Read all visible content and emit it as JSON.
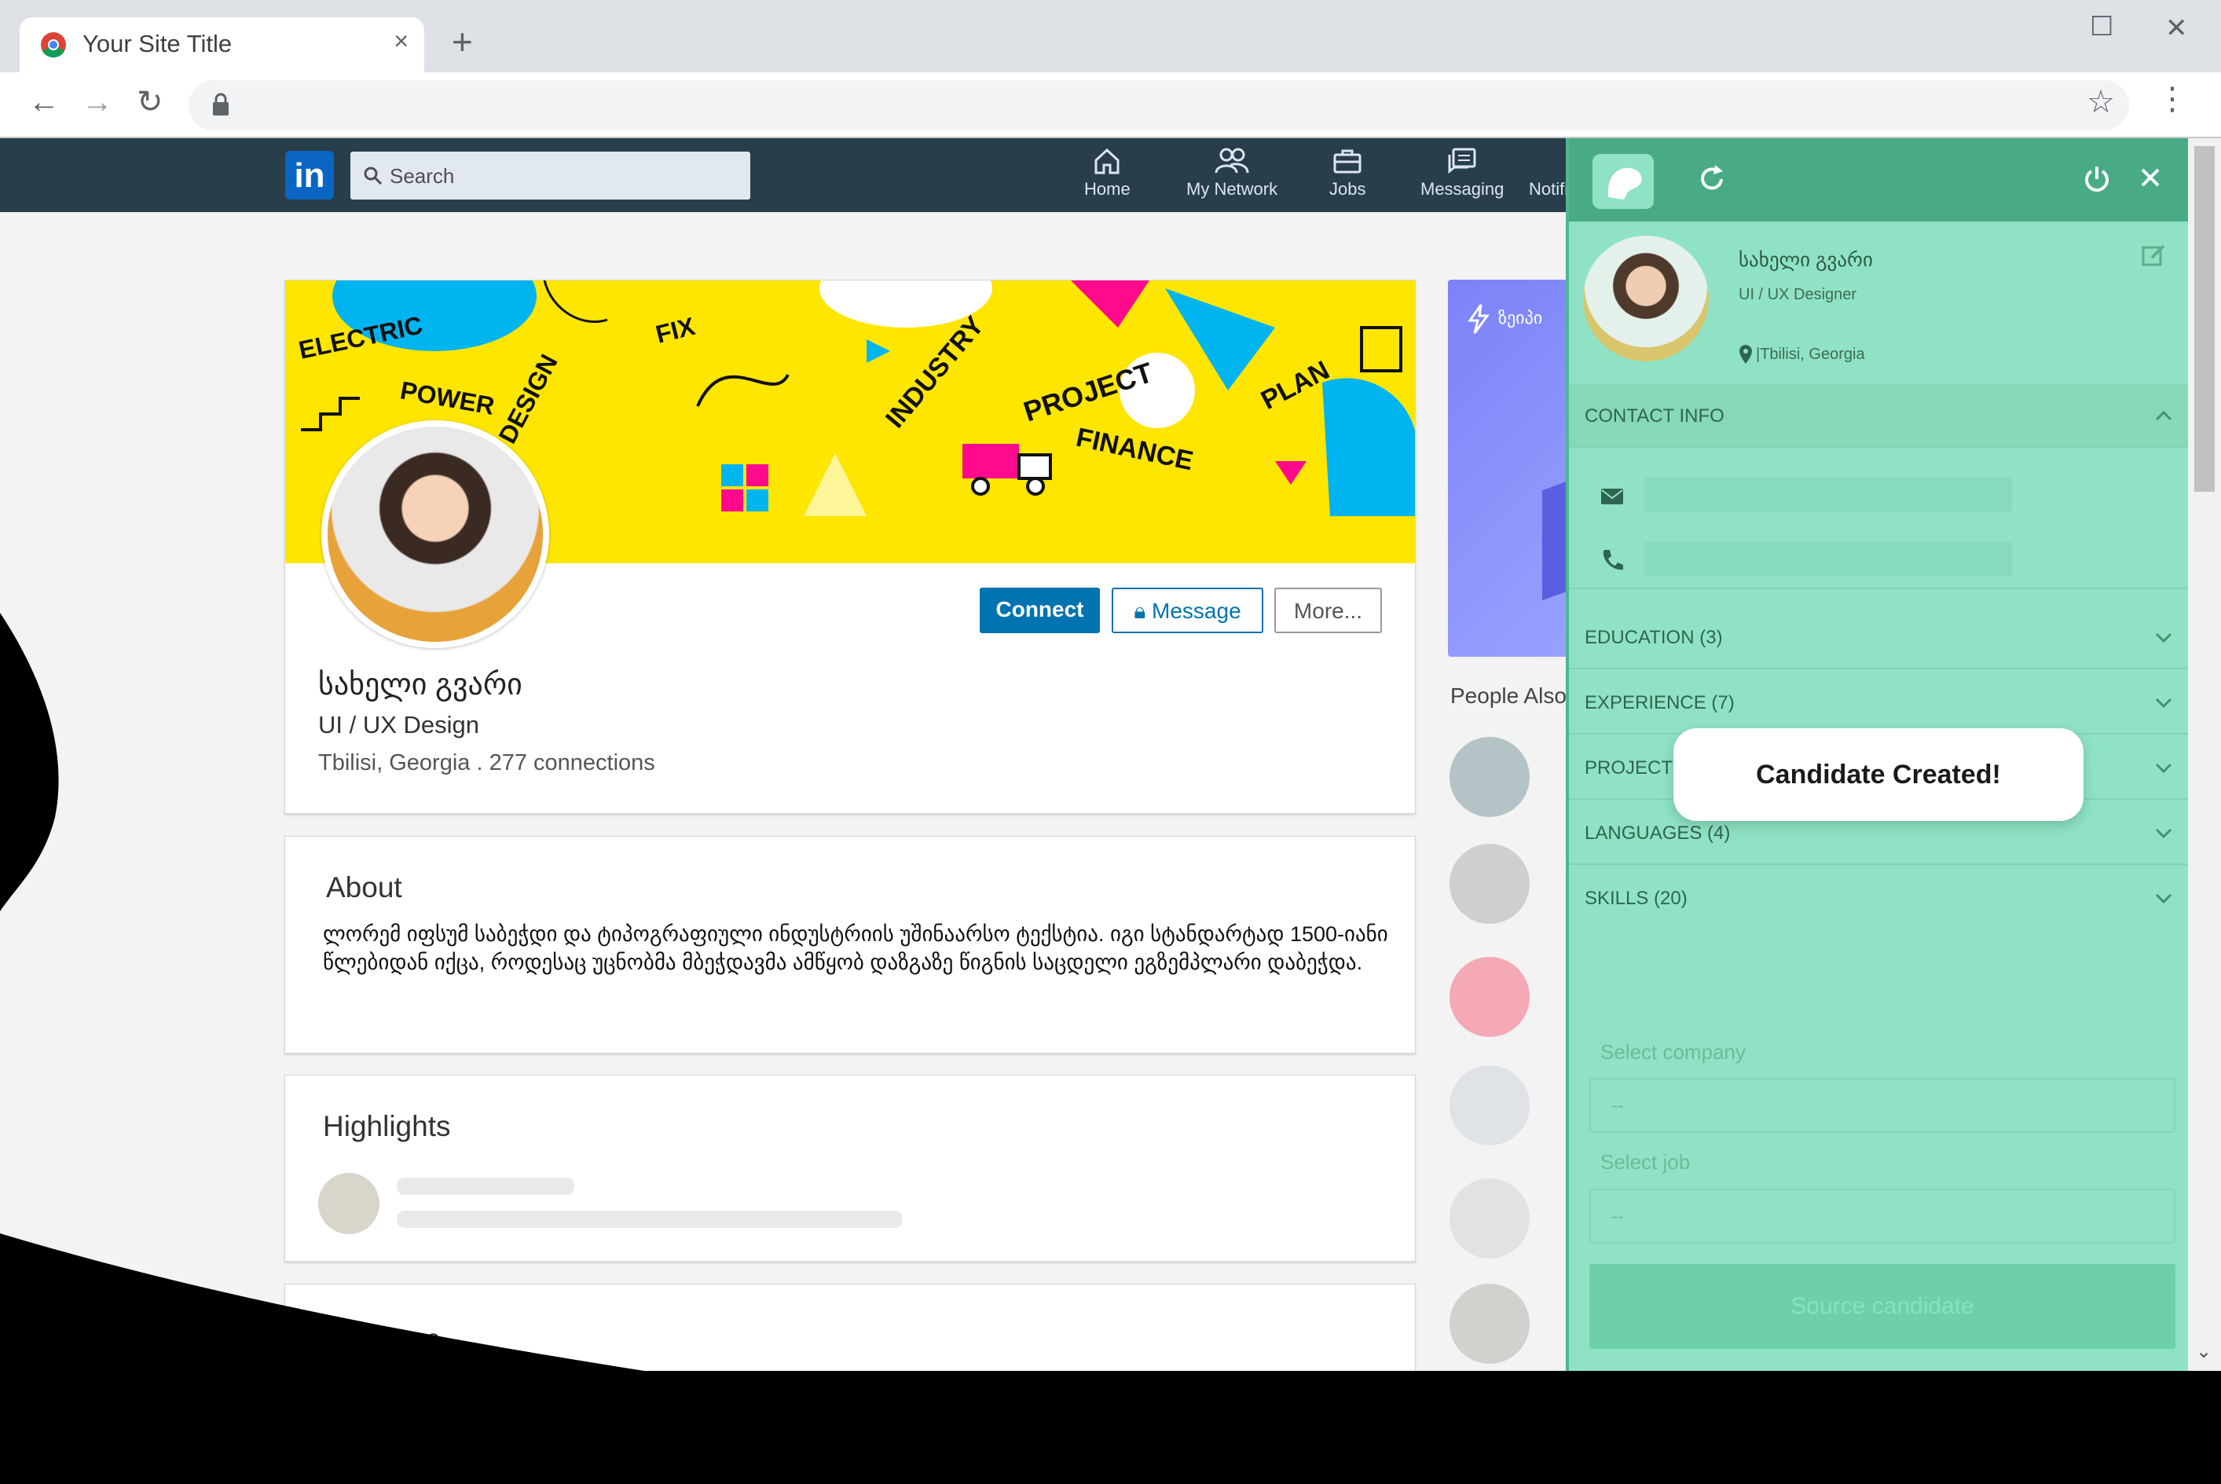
{
  "browser": {
    "tab_title": "Your Site Title",
    "tab_close": "×",
    "new_tab": "+",
    "address": ""
  },
  "linkedin": {
    "logo": "in",
    "search_placeholder": "Search",
    "nav": [
      {
        "label": "Home",
        "icon": "home-icon"
      },
      {
        "label": "My Network",
        "icon": "network-icon"
      },
      {
        "label": "Jobs",
        "icon": "jobs-icon"
      },
      {
        "label": "Messaging",
        "icon": "messaging-icon"
      },
      {
        "label": "Notifi",
        "icon": "notifications-icon"
      }
    ]
  },
  "profile": {
    "name": "სახელი გვარი",
    "title": "UI / UX Design",
    "location_connections": "Tbilisi, Georgia . 277 connections",
    "buttons": {
      "connect": "Connect",
      "message": "Message",
      "more": "More..."
    },
    "banner_words": [
      "ELECTRIC",
      "POWER",
      "DESIGN",
      "FIX",
      "INDUSTRY",
      "PROJECT",
      "FINANCE",
      "PLAN"
    ]
  },
  "about": {
    "heading": "About",
    "text": "ლორემ იფსუმ საბეჭდი და ტიპოგრაფიული ინდუსტრიის უშინაარსო ტექსტია. იგი სტანდარტად 1500-იანი წლებიდან იქცა, როდესაც უცნობმა მბეჭდავმა ამწყობ დაზგაზე წიგნის საცდელი ეგზემპლარი დაბეჭდა."
  },
  "highlights": {
    "heading": "Highlights"
  },
  "next_section": {
    "heading": "...ce"
  },
  "sidebar": {
    "ad_text": "ზეიპი",
    "people_also": "People Also",
    "people_colors": [
      "#b4c3c6",
      "#cfcfd1",
      "#f4a9b5",
      "#dfe2e6",
      "#e2e2e2",
      "#d3d1cd"
    ]
  },
  "extension": {
    "candidate": {
      "name": "სახელი გვარი",
      "role": "UI / UX Designer",
      "location": "|Tbilisi, Georgia"
    },
    "sections": [
      {
        "label": "CONTACT INFO",
        "expanded": true
      },
      {
        "label": "EDUCATION (3)",
        "expanded": false
      },
      {
        "label": "EXPERIENCE (7)",
        "expanded": false
      },
      {
        "label": "PROJECTS",
        "expanded": false
      },
      {
        "label": "LANGUAGES (4)",
        "expanded": false
      },
      {
        "label": "SKILLS (20)",
        "expanded": false
      }
    ],
    "select_company_label": "Select company",
    "select_company_value": "--",
    "select_job_label": "Select job",
    "select_job_value": "--",
    "source_button": "Source candidate"
  },
  "toast": {
    "message": "Candidate Created!"
  },
  "colors": {
    "linkedin_header": "#283e4a",
    "linkedin_blue": "#0073b1",
    "ext_bg": "#8fe3c4",
    "ext_header": "#48ab86",
    "banner_yellow": "#ffe600"
  }
}
